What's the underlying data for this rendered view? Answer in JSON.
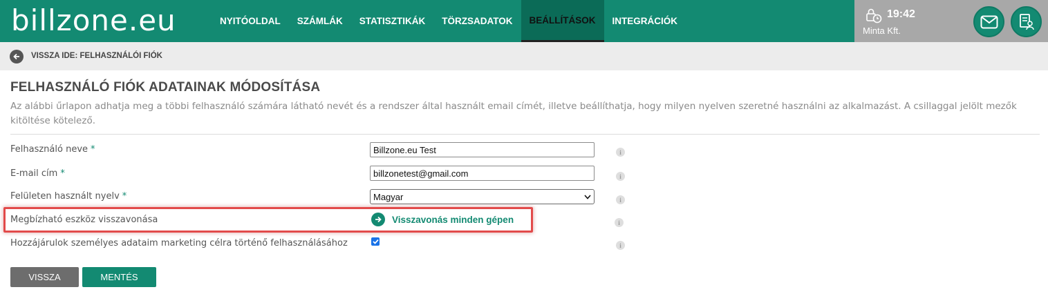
{
  "header": {
    "logo": "billzone.eu",
    "nav": [
      {
        "label": "NYITÓOLDAL",
        "active": false
      },
      {
        "label": "SZÁMLÁK",
        "active": false
      },
      {
        "label": "STATISZTIKÁK",
        "active": false
      },
      {
        "label": "TÖRZSADATOK",
        "active": false
      },
      {
        "label": "BEÁLLÍTÁSOK",
        "active": true
      },
      {
        "label": "INTEGRÁCIÓK",
        "active": false
      }
    ],
    "time": "19:42",
    "company": "Minta Kft.",
    "icons": {
      "clock": "lock-clock-icon",
      "mail": "mail-icon",
      "doc": "document-user-icon"
    }
  },
  "backbar": {
    "label": "VISSZA IDE: FELHASZNÁLÓI FIÓK",
    "icon": "arrow-left-icon"
  },
  "page": {
    "title": "FELHASZNÁLÓ FIÓK ADATAINAK MÓDOSÍTÁSA",
    "description": "Az alábbi űrlapon adhatja meg a többi felhasználó számára látható nevét és a rendszer által használt email címét, illetve beállíthatja, hogy milyen nyelven szeretné használni az alkalmazást. A csillaggal jelölt mezők kitöltése kötelező."
  },
  "form": {
    "name_label": "Felhasználó neve",
    "name_value": "Billzone.eu Test",
    "email_label": "E-mail cím",
    "email_value": "billzonetest@gmail.com",
    "language_label": "Felületen használt nyelv",
    "language_value": "Magyar",
    "required_mark": "*",
    "trusted_label": "Megbízható eszköz visszavonása",
    "trusted_link": "Visszavonás minden gépen",
    "marketing_label": "Hozzájárulok személyes adataim marketing célra történő felhasználásához",
    "marketing_checked": true,
    "info_glyph": "i"
  },
  "buttons": {
    "back": "VISSZA",
    "save": "MENTÉS"
  },
  "colors": {
    "brand": "#138a72",
    "highlight": "#e24a4a",
    "checkbox": "#1a73e8"
  }
}
